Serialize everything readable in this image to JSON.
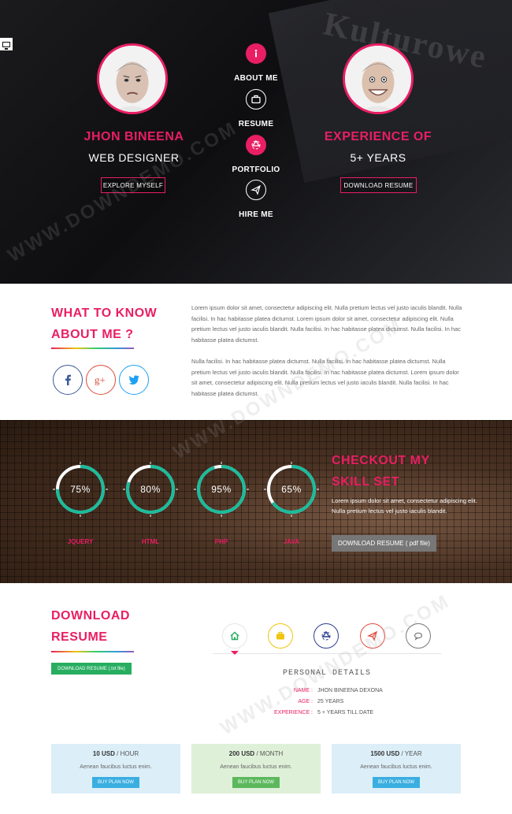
{
  "hero": {
    "bg_text": "Kulturowe",
    "left": {
      "name": "JHON BINEENA",
      "role": "WEB DESIGNER",
      "button": "EXPLORE MYSELF"
    },
    "right": {
      "name": "EXPERIENCE OF",
      "role": "5+ YEARS",
      "button": "DOWNLOAD RESUME"
    },
    "nav": [
      {
        "label": "ABOUT ME",
        "icon": "info-icon"
      },
      {
        "label": "RESUME",
        "icon": "briefcase-icon"
      },
      {
        "label": "PORTFOLIO",
        "icon": "recycle-icon"
      },
      {
        "label": "HIRE ME",
        "icon": "paper-plane-icon"
      }
    ]
  },
  "about": {
    "title_line1": "WHAT TO KNOW",
    "title_line2": "ABOUT ME ?",
    "para1": "Lorem ipsum dolor sit amet, consectetur adipiscing elit. Nulla pretium lectus vel justo iaculis blandit. Nulla facilisi. In hac habitasse platea dictumst. Lorem ipsum dolor sit amet, consectetur adipiscing elit. Nulla pretium lectus vel justo iaculis blandit. Nulla facilisi. In hac habitasse platea dictumst. Nulla facilisi. In hac habitasse platea dictumst.",
    "para2": "Nulla facilisi. In hac habitasse platea dictumst. Nulla facilisi. In hac habitasse platea dictumst. Nulla pretium lectus vel justo iaculis blandit. Nulla facilisi. In hac habitasse platea dictumst. Lorem ipsum dolor sit amet, consectetur adipiscing elit. Nulla pretium lectus vel justo iaculis blandit. Nulla facilisi. In hac habitasse platea dictumst.",
    "social": [
      {
        "name": "facebook-icon",
        "glyph": "f",
        "color": "#3b5998"
      },
      {
        "name": "google-plus-icon",
        "glyph": "g+",
        "color": "#dd4b39"
      },
      {
        "name": "twitter-icon",
        "glyph": "t",
        "color": "#1da1f2"
      }
    ]
  },
  "skills": {
    "title_line1": "CHECKOUT MY",
    "title_line2": "SKILL SET",
    "text": "Lorem ipsum dolor sit amet, consectetur adipiscing elit. Nulla pretium lectus vel justo iaculis blandit.",
    "button": "DOWNLOAD RESUME ( pdf file)",
    "items": [
      {
        "label": "75%",
        "name": "JQUERY",
        "value": 0.75
      },
      {
        "label": "80%",
        "name": "HTML",
        "value": 0.8
      },
      {
        "label": "95%",
        "name": "PHP",
        "value": 0.95
      },
      {
        "label": "65%",
        "name": "JAVA",
        "value": 0.65
      }
    ],
    "ring_color": "#1abc9c"
  },
  "resume": {
    "title_line1": "DOWNLOAD",
    "title_line2": "RESUME",
    "button": "DOWNLOAD RESUME (.txt file)",
    "tabs": [
      {
        "icon": "home-icon",
        "color": "#27ae60"
      },
      {
        "icon": "briefcase-icon",
        "color": "#f1c40f"
      },
      {
        "icon": "recycle-icon",
        "color": "#2c3e8f"
      },
      {
        "icon": "paper-plane-icon",
        "color": "#e74c3c"
      },
      {
        "icon": "chat-icon",
        "color": "#777777"
      }
    ],
    "details_title": "PERSONAL DETAILS",
    "details": [
      {
        "key": "NAME :",
        "value": "JHON BINEENA DEXONA"
      },
      {
        "key": "AGE :",
        "value": "25 YEARS"
      },
      {
        "key": "EXPERIENCE :",
        "value": "5 + YEARS TILL DATE"
      }
    ]
  },
  "plans": [
    {
      "price": "10 USD",
      "period": "/ HOUR",
      "desc": "Aenean faucibus luctus enim.",
      "button": "BUY PLAN NOW",
      "bg": "#dceef8",
      "btn": "#3aaee0"
    },
    {
      "price": "200 USD",
      "period": "/ MONTH",
      "desc": "Aenean faucibus luctus enim.",
      "button": "BUY PLAN NOW",
      "bg": "#dff0d8",
      "btn": "#5cb85c"
    },
    {
      "price": "1500 USD",
      "period": "/ YEAR",
      "desc": "Aenean faucibus luctus enim.",
      "button": "BUY PLAN NOW",
      "bg": "#dceef8",
      "btn": "#3aaee0"
    }
  ],
  "watermark": "WWW.DOWNDEMO.COM"
}
